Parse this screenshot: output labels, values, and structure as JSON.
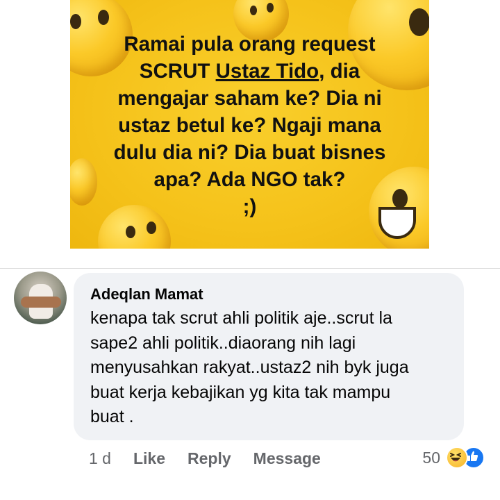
{
  "post": {
    "lines": [
      "Ramai pula orang request",
      "SCRUT",
      "Ustaz Tido",
      ", dia",
      "mengajar saham ke? Dia ni",
      "ustaz betul ke? Ngaji mana",
      "dulu dia ni? Dia buat bisnes",
      "apa? Ada NGO tak?",
      ";)"
    ]
  },
  "comment": {
    "author": "Adeqlan Mamat",
    "text_lines": [
      "kenapa tak scrut ahli politik aje..scrut la",
      "sape2 ahli politik..diaorang nih lagi",
      "menyusahkan rakyat..ustaz2 nih byk juga",
      "buat kerja kebajikan yg kita tak mampu",
      "buat ."
    ],
    "time": "1 d",
    "actions": {
      "like": "Like",
      "reply": "Reply",
      "message": "Message"
    },
    "reaction_count": "50",
    "reaction_icons": [
      "haha-icon",
      "like-icon"
    ],
    "colors": {
      "bubble": "#f0f2f5",
      "like_blue": "#1877f2",
      "meta_gray": "#65676b"
    }
  }
}
